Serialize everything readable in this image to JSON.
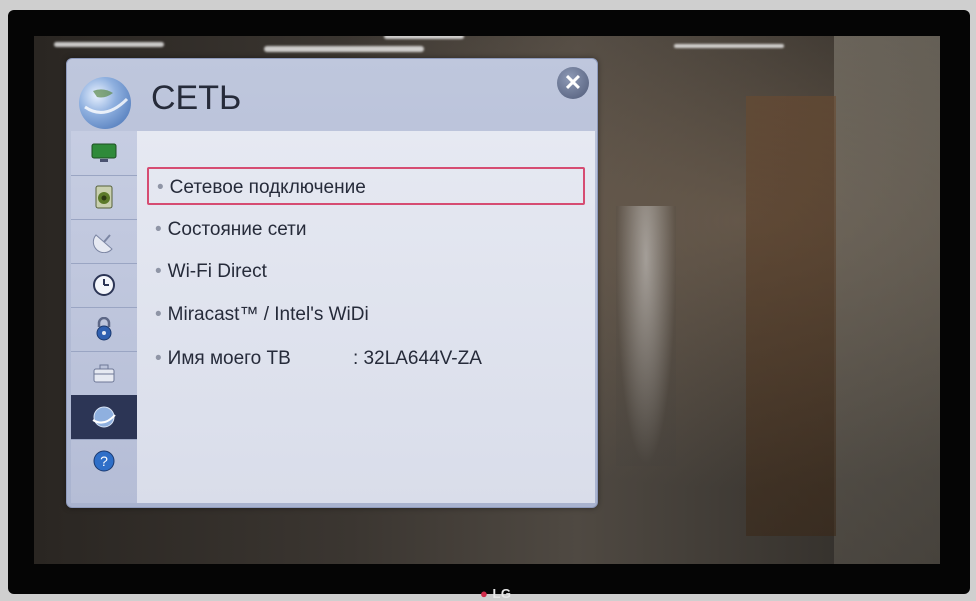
{
  "window": {
    "title": "СЕТЬ",
    "close_icon": "close-icon"
  },
  "sidebar": {
    "items": [
      {
        "name": "picture",
        "icon": "tv-picture-icon"
      },
      {
        "name": "sound",
        "icon": "speaker-icon"
      },
      {
        "name": "channels",
        "icon": "satellite-dish-icon"
      },
      {
        "name": "time",
        "icon": "clock-icon"
      },
      {
        "name": "lock",
        "icon": "lock-icon"
      },
      {
        "name": "options",
        "icon": "briefcase-icon"
      },
      {
        "name": "network",
        "icon": "globe-icon",
        "selected": true
      },
      {
        "name": "support",
        "icon": "help-icon"
      }
    ]
  },
  "menu": {
    "items": [
      {
        "label": "Сетевое подключение",
        "focused": true
      },
      {
        "label": "Состояние сети"
      },
      {
        "label": "Wi-Fi Direct"
      },
      {
        "label": "Miracast™ / Intel's WiDi"
      },
      {
        "label": "Имя моего ТВ",
        "value": ": 32LA644V-ZA"
      }
    ]
  },
  "tv": {
    "brand": "LG"
  },
  "colors": {
    "focus_border": "#d64c72",
    "selected_rail": "#2c3555",
    "panel": "#bfc7dd"
  }
}
